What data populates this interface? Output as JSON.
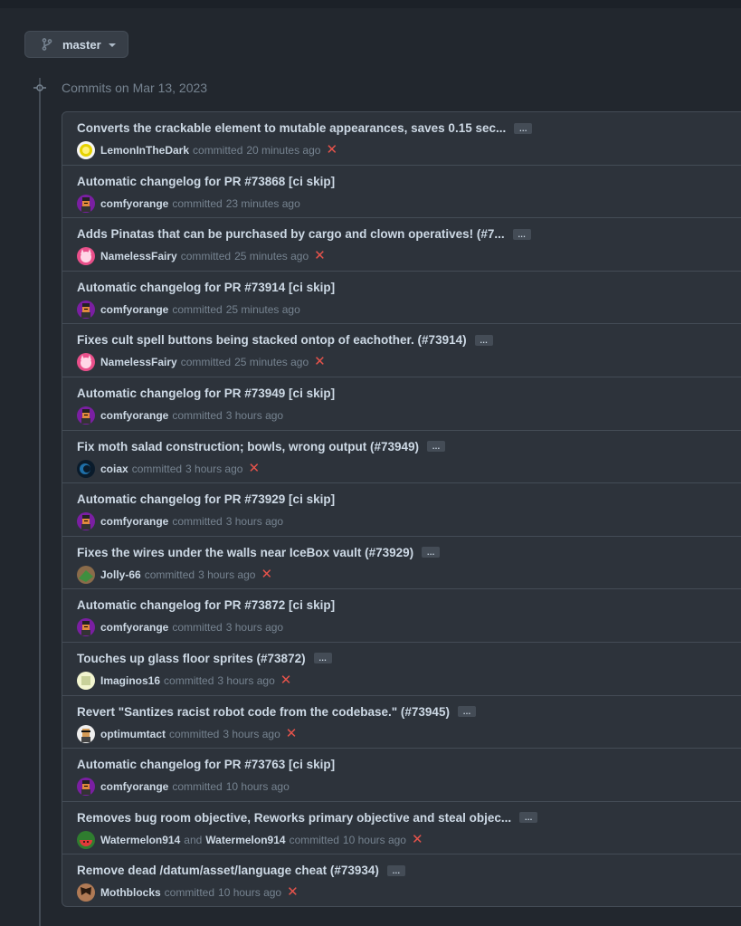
{
  "branch": {
    "label": "master"
  },
  "group": {
    "title": "Commits on Mar 13, 2023"
  },
  "commits": [
    {
      "message": "Converts the crackable element to mutable appearances, saves 0.15 sec...",
      "author": "LemonInTheDark",
      "verb": "committed",
      "time": "20 minutes ago",
      "ellipsis": "…",
      "status": "fail",
      "avatar": "lemon"
    },
    {
      "message": "Automatic changelog for PR #73868 [ci skip]",
      "author": "comfyorange",
      "verb": "committed",
      "time": "23 minutes ago",
      "status": "none",
      "avatar": "orange"
    },
    {
      "message": "Adds Pinatas that can be purchased by cargo and clown operatives! (#7...",
      "author": "NamelessFairy",
      "verb": "committed",
      "time": "25 minutes ago",
      "ellipsis": "…",
      "status": "fail",
      "avatar": "fairy"
    },
    {
      "message": "Automatic changelog for PR #73914 [ci skip]",
      "author": "comfyorange",
      "verb": "committed",
      "time": "25 minutes ago",
      "status": "none",
      "avatar": "orange"
    },
    {
      "message": "Fixes cult spell buttons being stacked ontop of eachother. (#73914)",
      "author": "NamelessFairy",
      "verb": "committed",
      "time": "25 minutes ago",
      "ellipsis": "…",
      "status": "fail",
      "avatar": "fairy"
    },
    {
      "message": "Automatic changelog for PR #73949 [ci skip]",
      "author": "comfyorange",
      "verb": "committed",
      "time": "3 hours ago",
      "status": "none",
      "avatar": "orange"
    },
    {
      "message": "Fix moth salad construction; bowls, wrong output (#73949)",
      "author": "coiax",
      "verb": "committed",
      "time": "3 hours ago",
      "ellipsis": "…",
      "status": "fail",
      "avatar": "coiax"
    },
    {
      "message": "Automatic changelog for PR #73929 [ci skip]",
      "author": "comfyorange",
      "verb": "committed",
      "time": "3 hours ago",
      "status": "none",
      "avatar": "orange"
    },
    {
      "message": "Fixes the wires under the walls near IceBox vault (#73929)",
      "author": "Jolly-66",
      "verb": "committed",
      "time": "3 hours ago",
      "ellipsis": "…",
      "status": "fail",
      "avatar": "jolly"
    },
    {
      "message": "Automatic changelog for PR #73872 [ci skip]",
      "author": "comfyorange",
      "verb": "committed",
      "time": "3 hours ago",
      "status": "none",
      "avatar": "orange"
    },
    {
      "message": "Touches up glass floor sprites (#73872)",
      "author": "Imaginos16",
      "verb": "committed",
      "time": "3 hours ago",
      "ellipsis": "…",
      "status": "fail",
      "avatar": "imaginos"
    },
    {
      "message": "Revert \"Santizes racist robot code from the codebase.\" (#73945)",
      "author": "optimumtact",
      "verb": "committed",
      "time": "3 hours ago",
      "ellipsis": "…",
      "status": "fail",
      "avatar": "optimum"
    },
    {
      "message": "Automatic changelog for PR #73763 [ci skip]",
      "author": "comfyorange",
      "verb": "committed",
      "time": "10 hours ago",
      "status": "none",
      "avatar": "orange"
    },
    {
      "message": "Removes bug room objective, Reworks primary objective and steal objec...",
      "author": "Watermelon914",
      "and": "and",
      "coauthor": "Watermelon914",
      "verb": "committed",
      "time": "10 hours ago",
      "ellipsis": "…",
      "status": "fail",
      "avatar": "melon"
    },
    {
      "message": "Remove dead /datum/asset/language cheat (#73934)",
      "author": "Mothblocks",
      "verb": "committed",
      "time": "10 hours ago",
      "ellipsis": "…",
      "status": "fail",
      "avatar": "moth"
    }
  ],
  "colors": {
    "fail": "#e5534b",
    "bg": "#22272e",
    "row_bg": "#2d333b",
    "border": "#444c56"
  }
}
